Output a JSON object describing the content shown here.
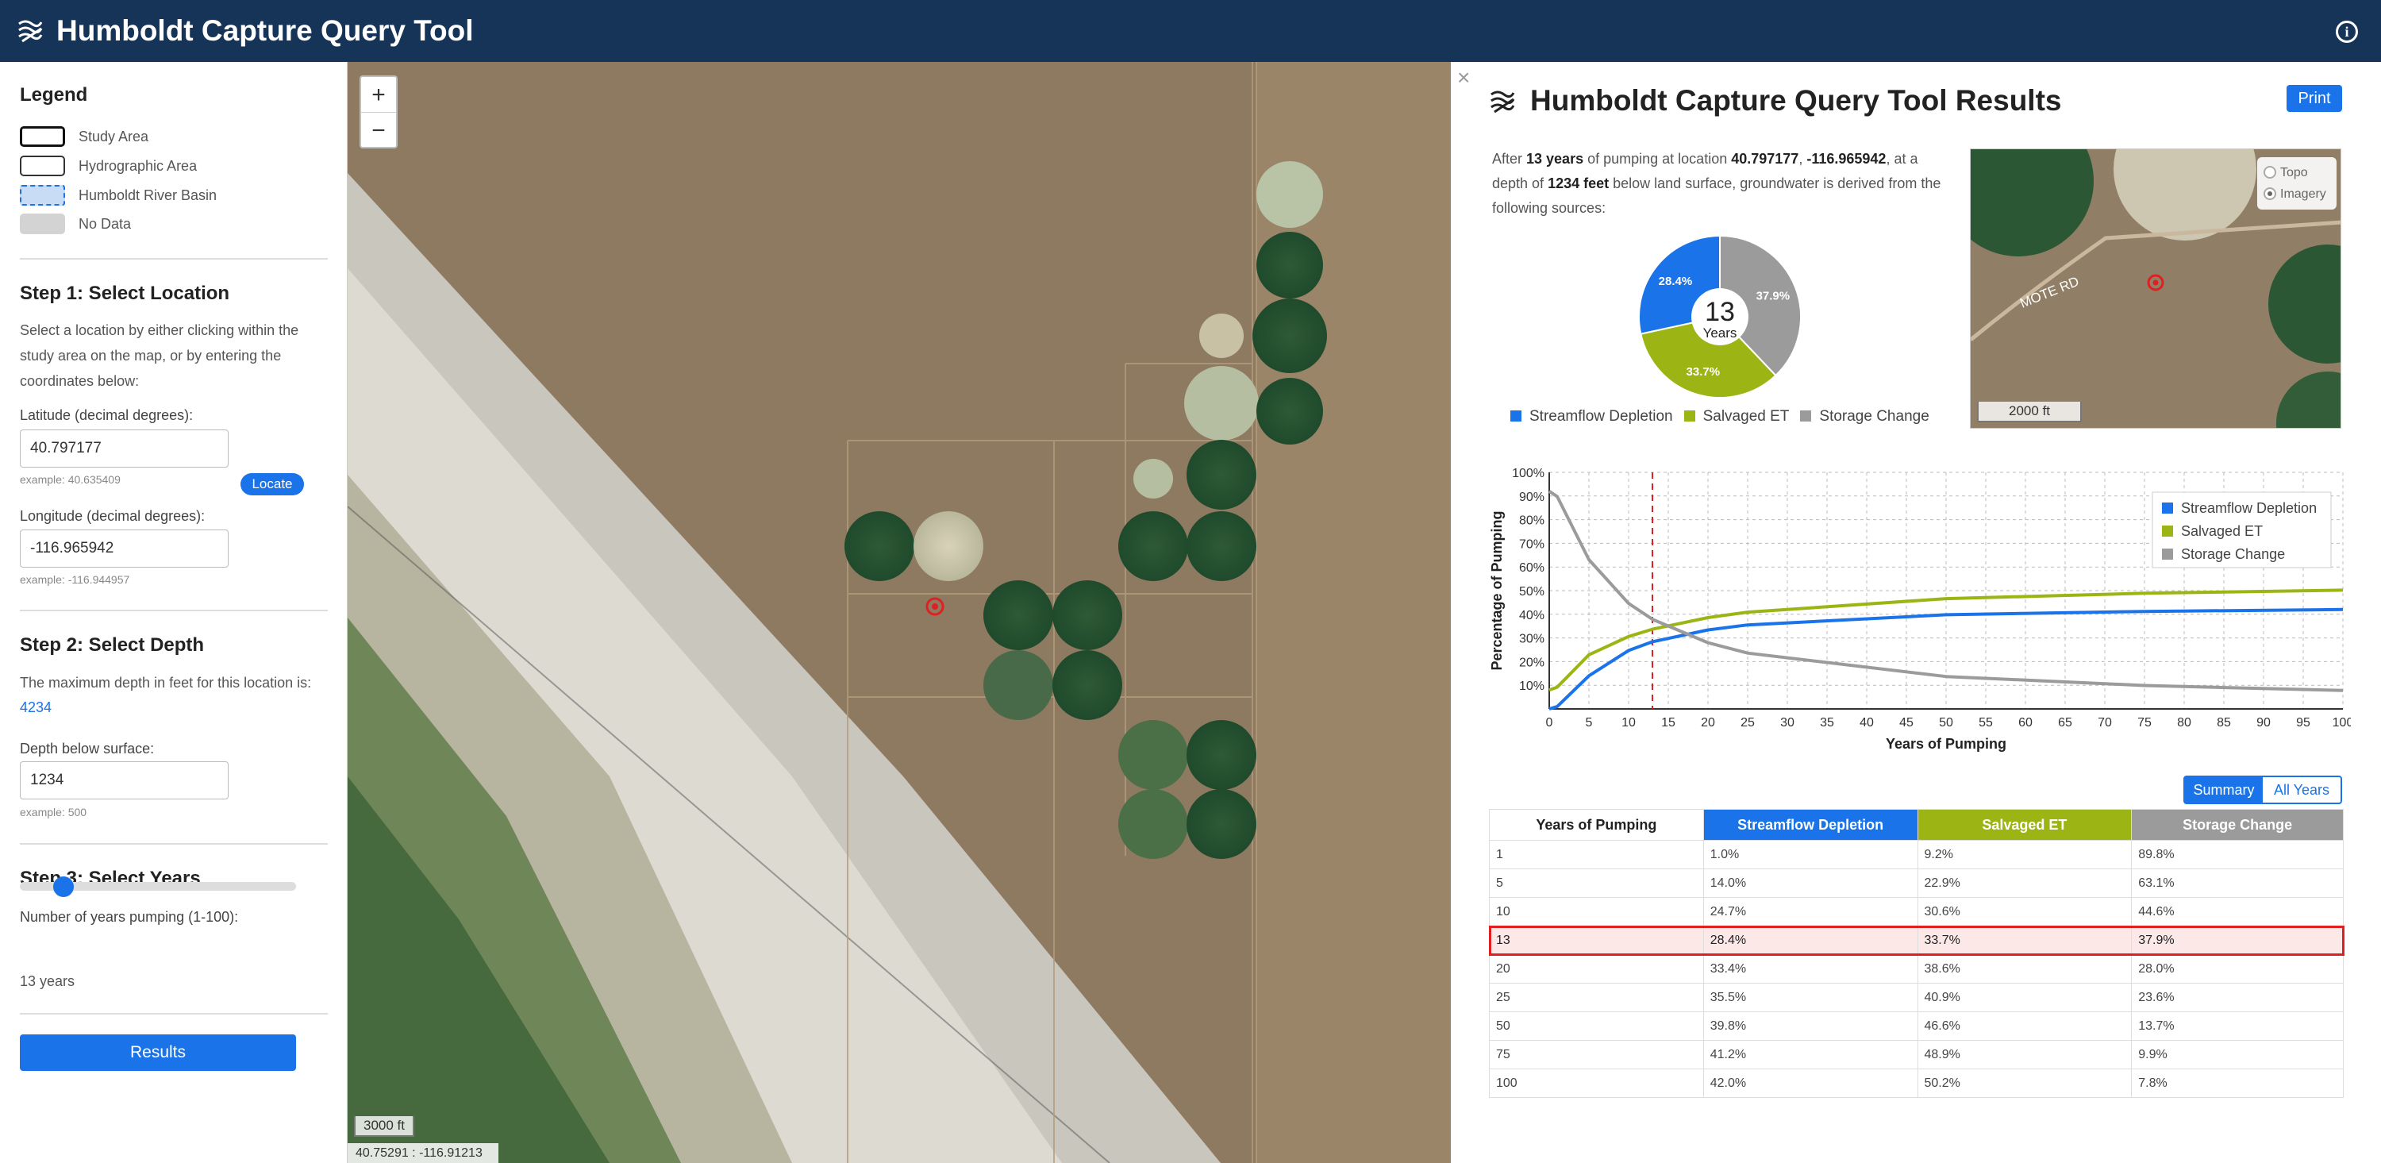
{
  "app": {
    "title": "Humboldt Capture Query Tool"
  },
  "legend": {
    "heading": "Legend",
    "items": [
      "Study Area",
      "Hydrographic Area",
      "Humboldt River Basin",
      "No Data"
    ]
  },
  "step1": {
    "heading": "Step 1: Select Location",
    "description": "Select a location by either clicking within the study area on the map, or by entering the coordinates below:",
    "lat_label": "Latitude (decimal degrees):",
    "lat_value": "40.797177",
    "lat_example": "example: 40.635409",
    "lon_label": "Longitude (decimal degrees):",
    "lon_value": "-116.965942",
    "lon_example": "example: -116.944957",
    "locate_label": "Locate"
  },
  "step2": {
    "heading": "Step 2: Select Depth",
    "description": "The maximum depth in feet for this location is:",
    "max_depth": "4234",
    "depth_label": "Depth below surface:",
    "depth_value": "1234",
    "depth_example": "example: 500"
  },
  "step3": {
    "heading": "Step 3: Select Years",
    "label": "Number of years pumping (1-100):",
    "years_value": 13,
    "years_text": "13 years"
  },
  "results_button": "Results",
  "map": {
    "zoom_in": "+",
    "zoom_out": "−",
    "scale": "3000 ft",
    "coords": "40.75291 : -116.91213"
  },
  "results": {
    "close": "×",
    "title": "Humboldt Capture Query Tool Results",
    "print_label": "Print",
    "summary": {
      "t1": "After ",
      "years": "13 years",
      "t2": " of pumping at location ",
      "lat": "40.797177",
      "t3": ", ",
      "lon": "-116.965942",
      "t4": ", at a depth of ",
      "depth": "1234 feet",
      "t5": " below land surface, groundwater is derived from the following sources:"
    },
    "pie": {
      "center_value": "13",
      "center_label": "Years",
      "slices": [
        {
          "name": "Streamflow Depletion",
          "value": 28.4,
          "label": "28.4%",
          "color": "#1a73e8"
        },
        {
          "name": "Salvaged ET",
          "value": 33.7,
          "label": "33.7%",
          "color": "#9cb515"
        },
        {
          "name": "Storage Change",
          "value": 37.9,
          "label": "37.9%",
          "color": "#9b9b9b"
        }
      ]
    },
    "inset": {
      "road_label": "MOTE RD",
      "scale": "2000 ft",
      "basemap_options": [
        "Topo",
        "Imagery"
      ],
      "basemap_selected": "Imagery"
    },
    "view_toggle": {
      "options": [
        "Summary",
        "All Years"
      ],
      "selected": "Summary"
    },
    "table": {
      "headers": [
        "Years of Pumping",
        "Streamflow Depletion",
        "Salvaged ET",
        "Storage Change"
      ],
      "header_colors": [
        "#ffffff",
        "#1a73e8",
        "#9cb515",
        "#9b9b9b"
      ],
      "rows": [
        [
          "1",
          "1.0%",
          "9.2%",
          "89.8%"
        ],
        [
          "5",
          "14.0%",
          "22.9%",
          "63.1%"
        ],
        [
          "10",
          "24.7%",
          "30.6%",
          "44.6%"
        ],
        [
          "13",
          "28.4%",
          "33.7%",
          "37.9%"
        ],
        [
          "20",
          "33.4%",
          "38.6%",
          "28.0%"
        ],
        [
          "25",
          "35.5%",
          "40.9%",
          "23.6%"
        ],
        [
          "50",
          "39.8%",
          "46.6%",
          "13.7%"
        ],
        [
          "75",
          "41.2%",
          "48.9%",
          "9.9%"
        ],
        [
          "100",
          "42.0%",
          "50.2%",
          "7.8%"
        ]
      ],
      "highlight_row": "13"
    }
  },
  "colors": {
    "header_bg": "#163457",
    "accent": "#1a73e8",
    "streamflow": "#1a73e8",
    "salvaged": "#9cb515",
    "storage": "#9b9b9b",
    "highlight_border": "#e02020",
    "marker": "#e02020"
  },
  "chart_data": {
    "type": "line",
    "xlabel": "Years of Pumping",
    "ylabel": "Percentage of Pumping",
    "xlim": [
      0,
      100
    ],
    "ylim": [
      0,
      100
    ],
    "x_ticks": [
      "0",
      "5",
      "10",
      "15",
      "20",
      "25",
      "30",
      "35",
      "40",
      "45",
      "50",
      "55",
      "60",
      "65",
      "70",
      "75",
      "80",
      "85",
      "90",
      "95",
      "100"
    ],
    "y_ticks": [
      "10%",
      "20%",
      "30%",
      "40%",
      "50%",
      "60%",
      "70%",
      "80%",
      "90%",
      "100%"
    ],
    "marker_year": 13,
    "grid": true,
    "legend": "top-right",
    "x": [
      0,
      1,
      5,
      10,
      13,
      20,
      25,
      50,
      75,
      100
    ],
    "series": [
      {
        "name": "Streamflow Depletion",
        "color": "#1a73e8",
        "values": [
          0,
          1.0,
          14.0,
          24.7,
          28.4,
          33.4,
          35.5,
          39.8,
          41.2,
          42.0
        ]
      },
      {
        "name": "Salvaged ET",
        "color": "#9cb515",
        "values": [
          8,
          9.2,
          22.9,
          30.6,
          33.7,
          38.6,
          40.9,
          46.6,
          48.9,
          50.2
        ]
      },
      {
        "name": "Storage Change",
        "color": "#9b9b9b",
        "values": [
          92,
          89.8,
          63.1,
          44.6,
          37.9,
          28.0,
          23.6,
          13.7,
          9.9,
          7.8
        ]
      }
    ]
  }
}
